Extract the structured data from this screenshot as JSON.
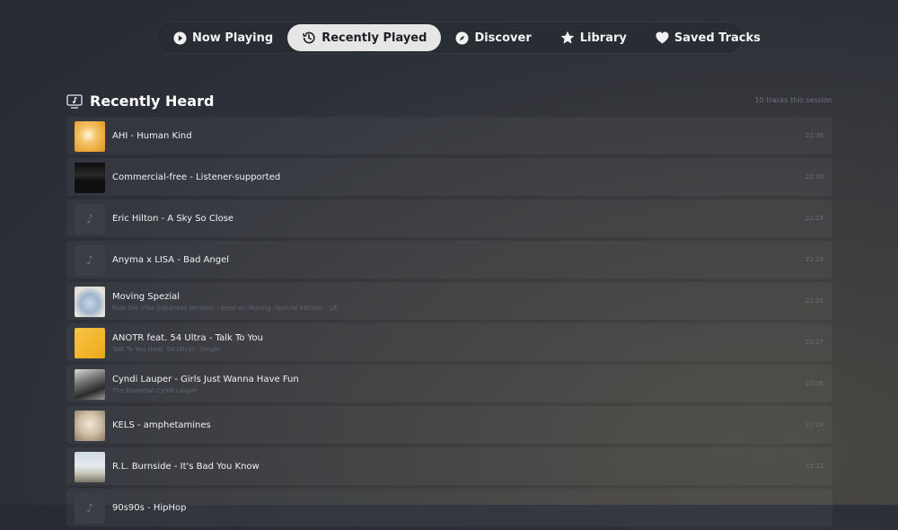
{
  "nav": {
    "tabs": [
      {
        "label": "Now Playing",
        "icon": "play-circle-icon",
        "active": false
      },
      {
        "label": "Recently Played",
        "icon": "history-icon",
        "active": true
      },
      {
        "label": "Discover",
        "icon": "compass-icon",
        "active": false
      },
      {
        "label": "Library",
        "icon": "star-icon",
        "active": false
      },
      {
        "label": "Saved Tracks",
        "icon": "heart-icon",
        "active": false
      }
    ]
  },
  "section": {
    "title": "Recently Heard",
    "icon": "music-screen-icon",
    "count": "10 tracks this session"
  },
  "tracks": [
    {
      "title": "AHI - Human Kind",
      "subtitle": "",
      "time": "22:36",
      "art": "yellow"
    },
    {
      "title": "Commercial-free - Listener-supported",
      "subtitle": "",
      "time": "22:30",
      "art": "dark"
    },
    {
      "title": "Eric Hilton - A Sky So Close",
      "subtitle": "",
      "time": "22:29",
      "art": "placeholder"
    },
    {
      "title": "Anyma x LISA - Bad Angel",
      "subtitle": "",
      "time": "22:29",
      "art": "placeholder"
    },
    {
      "title": "Moving Spezial",
      "subtitle": "Ride the Vibe (Japanese Version) · Keep on Moving -Special Edition- · LP",
      "time": "22:28",
      "art": "pastel"
    },
    {
      "title": "ANOTR feat. 54 Ultra - Talk To You",
      "subtitle": "Talk To You (feat. 54 Ultra) · Single",
      "time": "22:27",
      "art": "gold"
    },
    {
      "title": "Cyndi Lauper - Girls Just Wanna Have Fun",
      "subtitle": "The Essential Cyndi Lauper",
      "time": "22:26",
      "art": "bw"
    },
    {
      "title": "KELS - amphetamines",
      "subtitle": "",
      "time": "22:24",
      "art": "girl"
    },
    {
      "title": "R.L. Burnside - It's Bad You Know",
      "subtitle": "",
      "time": "22:22",
      "art": "sky"
    },
    {
      "title": "90s90s - HipHop",
      "subtitle": "",
      "time": "",
      "art": "placeholder"
    }
  ],
  "colors": {
    "active_tab_bg": "#e6e6e6",
    "background": "#2d3038",
    "row_bg": "rgba(255,255,255,0.045)"
  }
}
